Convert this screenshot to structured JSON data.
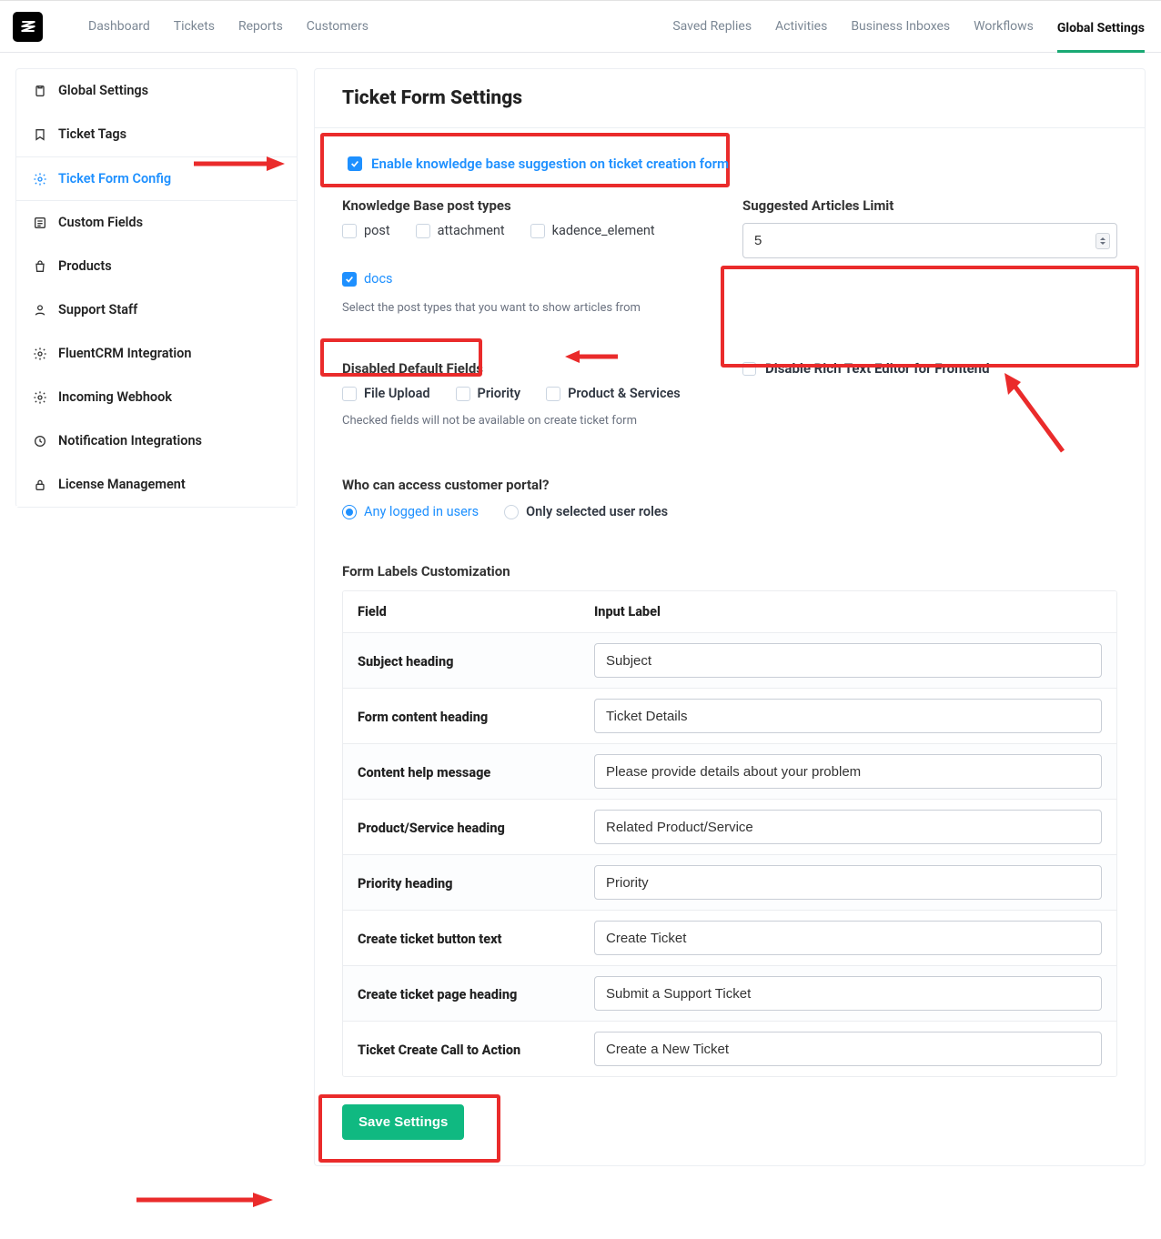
{
  "topnav": {
    "left": [
      {
        "label": "Dashboard"
      },
      {
        "label": "Tickets"
      },
      {
        "label": "Reports"
      },
      {
        "label": "Customers"
      }
    ],
    "right": [
      {
        "label": "Saved Replies"
      },
      {
        "label": "Activities"
      },
      {
        "label": "Business Inboxes"
      },
      {
        "label": "Workflows"
      },
      {
        "label": "Global Settings",
        "active": true
      }
    ]
  },
  "sidebar": {
    "items": [
      {
        "label": "Global Settings",
        "icon": "clipboard-icon"
      },
      {
        "label": "Ticket Tags",
        "icon": "bookmark-icon"
      },
      {
        "label": "Ticket Form Config",
        "icon": "gear-icon",
        "active": true
      },
      {
        "label": "Custom Fields",
        "icon": "list-icon"
      },
      {
        "label": "Products",
        "icon": "bag-icon"
      },
      {
        "label": "Support Staff",
        "icon": "user-icon"
      },
      {
        "label": "FluentCRM Integration",
        "icon": "gear-icon"
      },
      {
        "label": "Incoming Webhook",
        "icon": "gear-icon"
      },
      {
        "label": "Notification Integrations",
        "icon": "bell-icon"
      },
      {
        "label": "License Management",
        "icon": "lock-icon"
      }
    ]
  },
  "page": {
    "title": "Ticket Form Settings",
    "enable_kb": {
      "checked": true,
      "label": "Enable knowledge base suggestion on ticket creation form"
    },
    "kb_post_types": {
      "heading": "Knowledge Base post types",
      "help": "Select the post types that you want to show articles from",
      "items": [
        {
          "key": "post",
          "label": "post",
          "checked": false
        },
        {
          "key": "attachment",
          "label": "attachment",
          "checked": false
        },
        {
          "key": "kadence_element",
          "label": "kadence_element",
          "checked": false
        },
        {
          "key": "docs",
          "label": "docs",
          "checked": true
        }
      ]
    },
    "suggested_limit": {
      "heading": "Suggested Articles Limit",
      "value": "5"
    },
    "disabled_fields": {
      "heading": "Disabled Default Fields",
      "help": "Checked fields will not be available on create ticket form",
      "items": [
        {
          "label": "File Upload",
          "checked": false
        },
        {
          "label": "Priority",
          "checked": false
        },
        {
          "label": "Product & Services",
          "checked": false
        }
      ],
      "disable_rich": {
        "label": "Disable Rich Text Editor for Frontend",
        "checked": false
      }
    },
    "portal_access": {
      "heading": "Who can access customer portal?",
      "options": [
        {
          "label": "Any logged in users",
          "checked": true
        },
        {
          "label": "Only selected user roles",
          "checked": false
        }
      ]
    },
    "form_labels": {
      "heading": "Form Labels Customization",
      "columns": {
        "field": "Field",
        "input": "Input Label"
      },
      "rows": [
        {
          "field": "Subject heading",
          "value": "Subject"
        },
        {
          "field": "Form content heading",
          "value": "Ticket Details"
        },
        {
          "field": "Content help message",
          "value": "Please provide details about your problem"
        },
        {
          "field": "Product/Service heading",
          "value": "Related Product/Service"
        },
        {
          "field": "Priority heading",
          "value": "Priority"
        },
        {
          "field": "Create ticket button text",
          "value": "Create Ticket"
        },
        {
          "field": "Create ticket page heading",
          "value": "Submit a Support Ticket"
        },
        {
          "field": "Ticket Create Call to Action",
          "value": "Create a New Ticket"
        }
      ]
    },
    "save_label": "Save Settings"
  }
}
